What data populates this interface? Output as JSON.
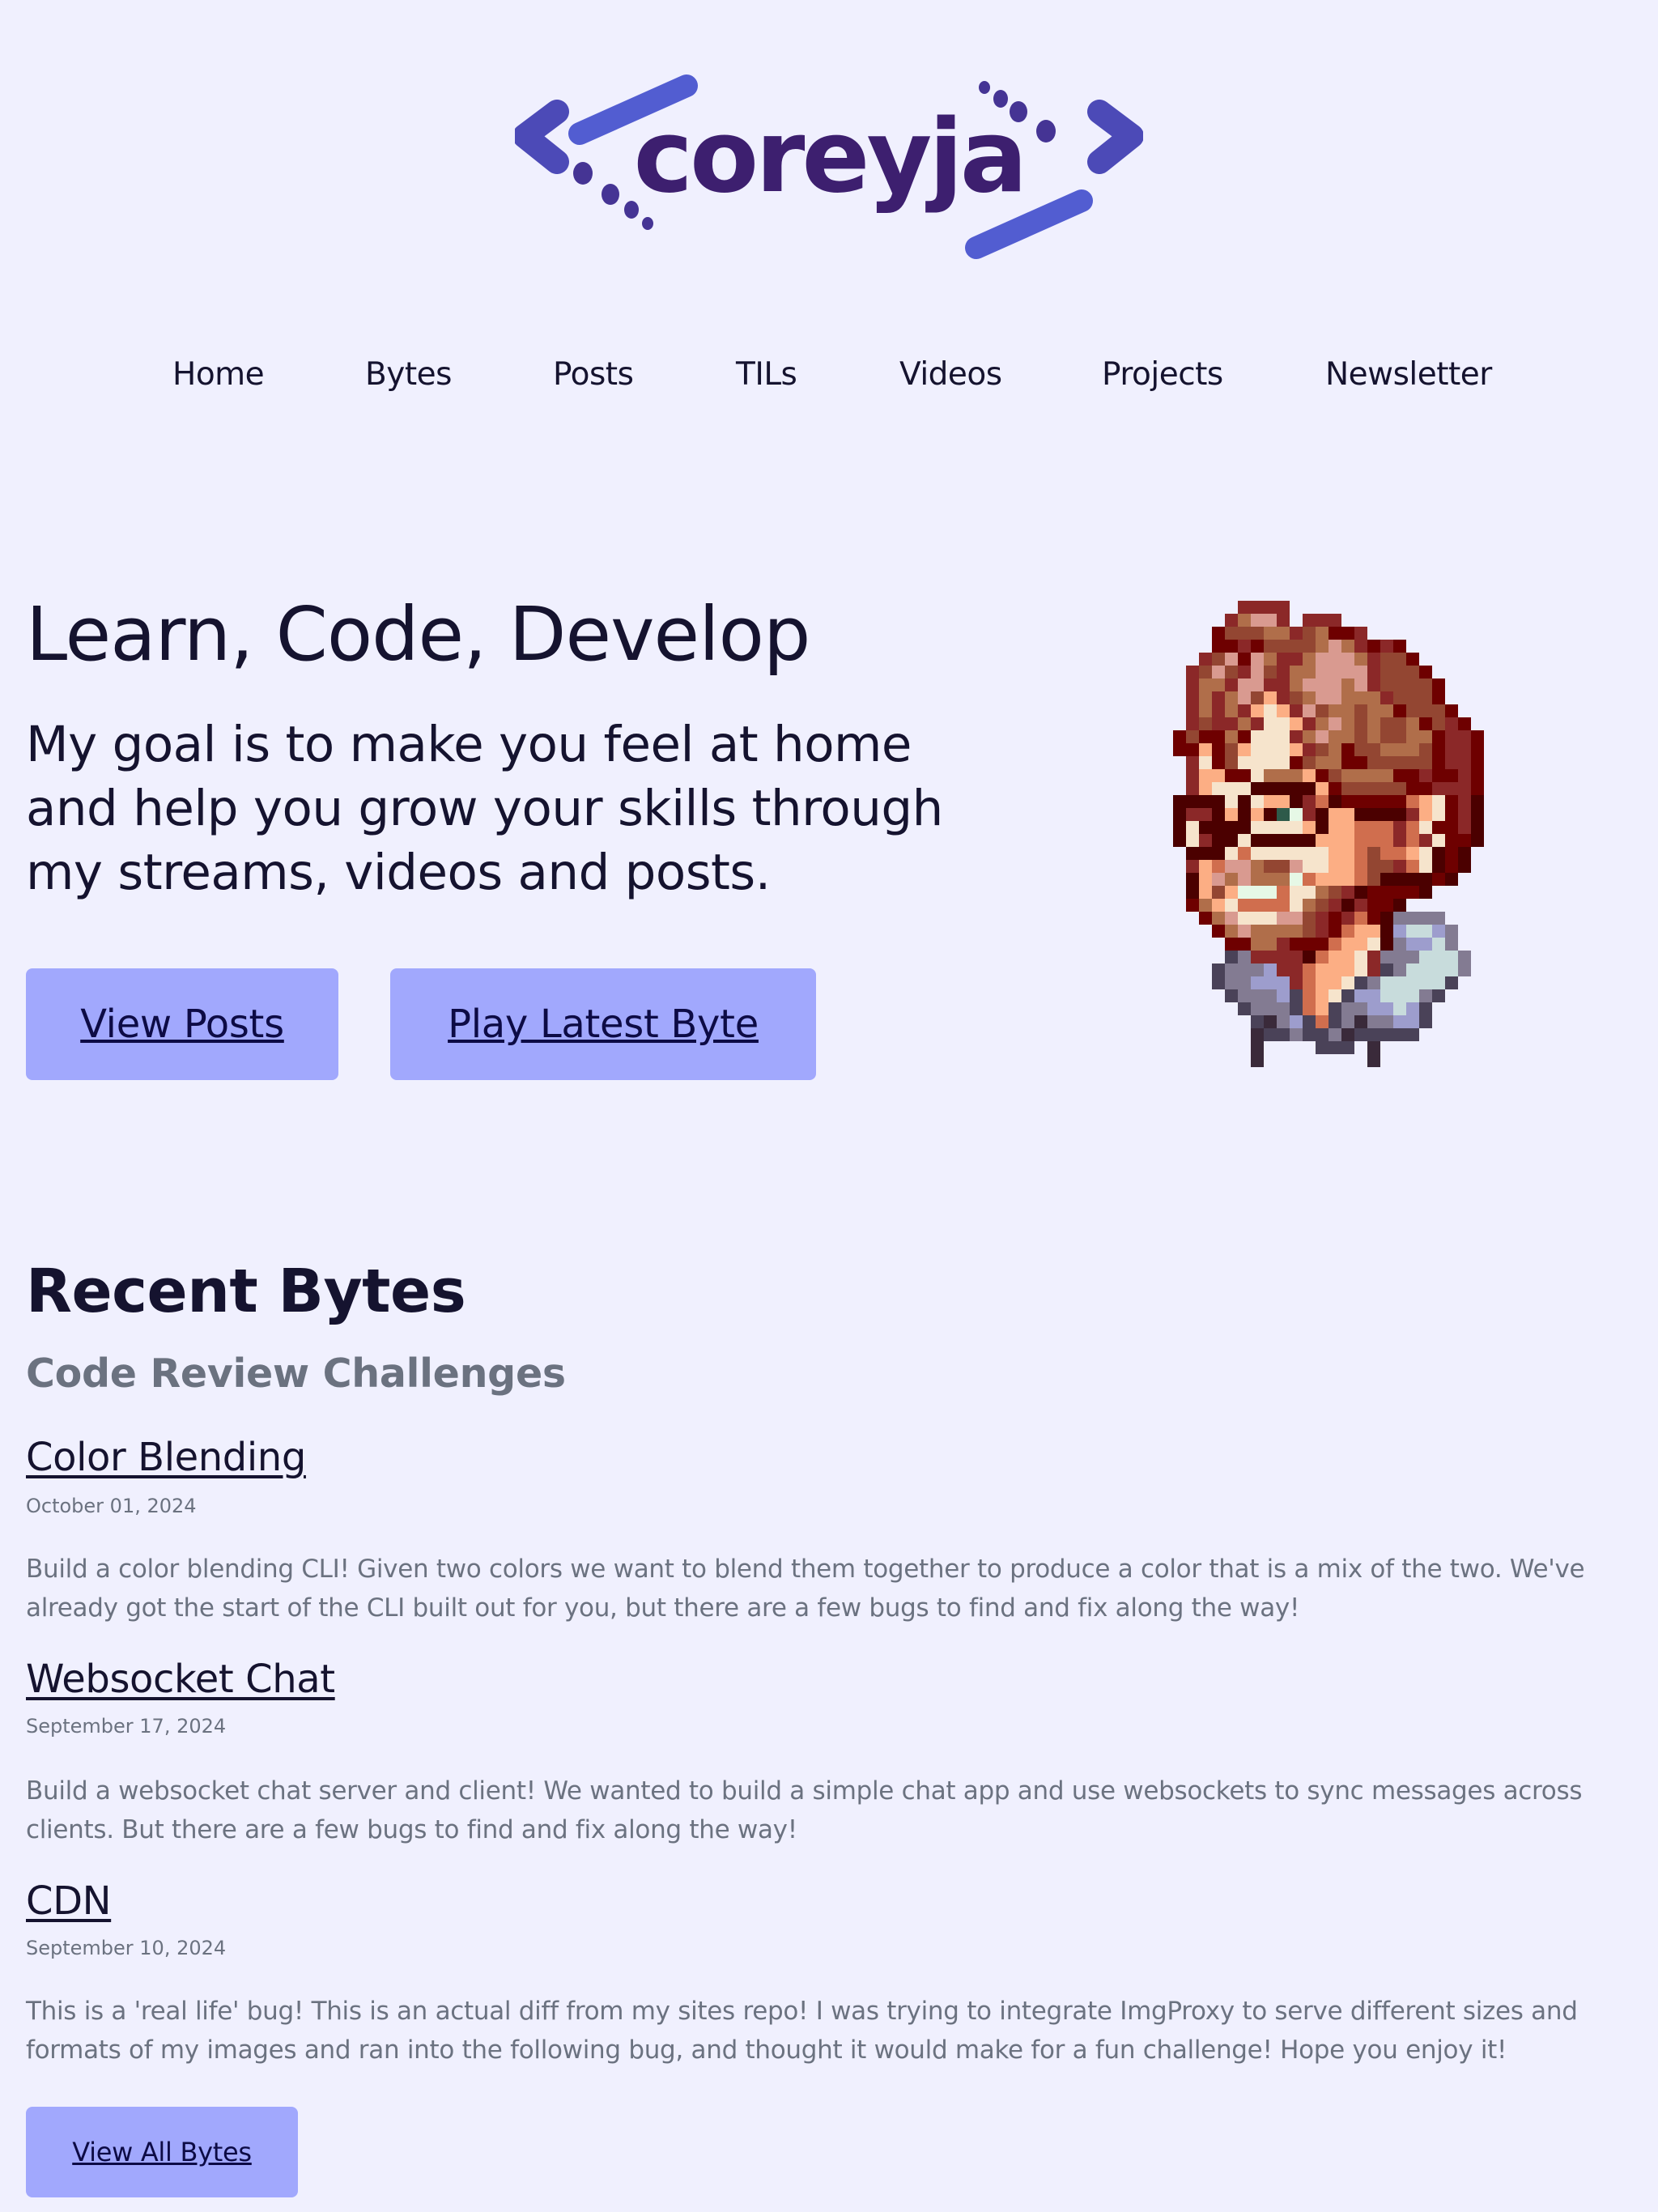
{
  "site": {
    "logo_text": "coreyja",
    "brand_colors": {
      "primary": "#525dd1",
      "dark": "#3d1f6f",
      "mid": "#493a9e"
    }
  },
  "nav": {
    "items": [
      {
        "label": "Home"
      },
      {
        "label": "Bytes"
      },
      {
        "label": "Posts"
      },
      {
        "label": "TILs"
      },
      {
        "label": "Videos"
      },
      {
        "label": "Projects"
      },
      {
        "label": "Newsletter"
      }
    ]
  },
  "hero": {
    "title": "Learn, Code, Develop",
    "subtitle": "My goal is to make you feel at home and help you grow your skills through my streams, videos and posts.",
    "buttons": {
      "view_posts": "View Posts",
      "play_latest_byte": "Play Latest Byte"
    },
    "avatar_alt": "pixel-art avatar"
  },
  "recent_bytes": {
    "title": "Recent Bytes",
    "subtitle": "Code Review Challenges",
    "items": [
      {
        "title": "Color Blending",
        "date": "October 01, 2024",
        "description": "Build a color blending CLI! Given two colors we want to blend them together to produce a color that is a mix of the two. We've already got the start of the CLI built out for you, but there are a few bugs to find and fix along the way!"
      },
      {
        "title": "Websocket Chat",
        "date": "September 17, 2024",
        "description": "Build a websocket chat server and client! We wanted to build a simple chat app and use websockets to sync messages across clients. But there are a few bugs to find and fix along the way!"
      },
      {
        "title": "CDN",
        "date": "September 10, 2024",
        "description": "This is a 'real life' bug! This is an actual diff from my sites repo! I was trying to integrate ImgProxy to serve different sizes and formats of my images and ran into the following bug, and thought it would make for a fun challenge! Hope you enjoy it!"
      }
    ],
    "view_all_label": "View All Bytes"
  },
  "theme": {
    "background": "#f0f0fe",
    "text": "#15132f",
    "muted": "#6b7280",
    "button_bg": "#a1a8fd",
    "button_text": "#0d0b45"
  }
}
